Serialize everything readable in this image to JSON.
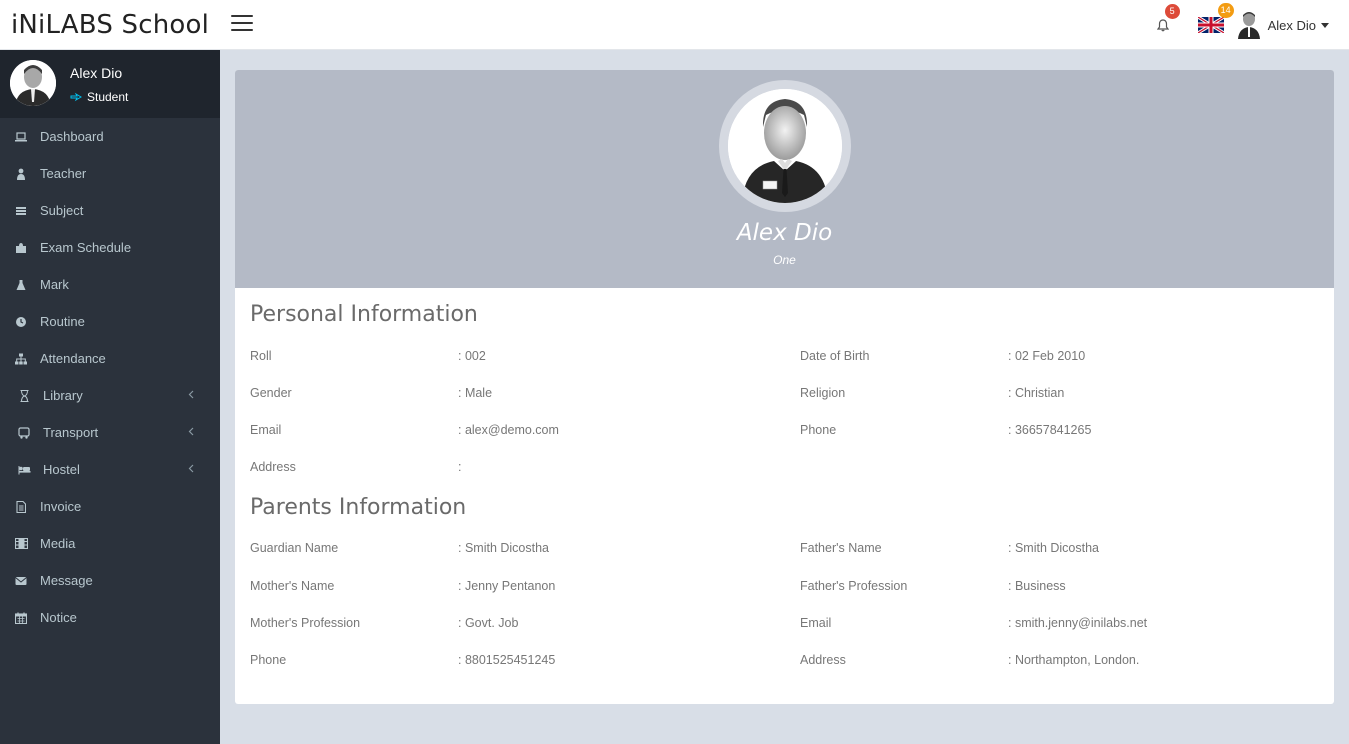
{
  "brand": "iNiLABS School",
  "header": {
    "notification_count": "5",
    "language_count": "14",
    "user_name": "Alex Dio"
  },
  "sidebar": {
    "user": {
      "name": "Alex Dio",
      "role": "Student"
    },
    "items": [
      {
        "label": "Dashboard",
        "icon": "laptop-icon"
      },
      {
        "label": "Teacher",
        "icon": "teacher-icon"
      },
      {
        "label": "Subject",
        "icon": "book-icon"
      },
      {
        "label": "Exam Schedule",
        "icon": "puzzle-icon"
      },
      {
        "label": "Mark",
        "icon": "flask-icon"
      },
      {
        "label": "Routine",
        "icon": "clock-icon"
      },
      {
        "label": "Attendance",
        "icon": "sitemap-icon"
      },
      {
        "label": "Library",
        "icon": "hourglass-icon",
        "expandable": true
      },
      {
        "label": "Transport",
        "icon": "bus-icon",
        "expandable": true
      },
      {
        "label": "Hostel",
        "icon": "bed-icon",
        "expandable": true
      },
      {
        "label": "Invoice",
        "icon": "invoice-icon"
      },
      {
        "label": "Media",
        "icon": "film-icon"
      },
      {
        "label": "Message",
        "icon": "envelope-icon"
      },
      {
        "label": "Notice",
        "icon": "calendar-icon"
      }
    ]
  },
  "profile": {
    "name": "Alex Dio",
    "class": "One"
  },
  "personal": {
    "title": "Personal Information",
    "left": [
      {
        "label": "Roll",
        "value": ": 002"
      },
      {
        "label": "Gender",
        "value": ": Male"
      },
      {
        "label": "Email",
        "value": ": alex@demo.com"
      },
      {
        "label": "Address",
        "value": ":"
      }
    ],
    "right": [
      {
        "label": "Date of Birth",
        "value": ": 02 Feb 2010"
      },
      {
        "label": "Religion",
        "value": ": Christian"
      },
      {
        "label": "Phone",
        "value": ": 36657841265"
      }
    ]
  },
  "parents": {
    "title": "Parents Information",
    "left": [
      {
        "label": "Guardian Name",
        "value": ": Smith Dicostha"
      },
      {
        "label": "Mother's Name",
        "value": ": Jenny Pentanon"
      },
      {
        "label": "Mother's Profession",
        "value": ": Govt. Job"
      },
      {
        "label": "Phone",
        "value": ": 8801525451245"
      }
    ],
    "right": [
      {
        "label": "Father's Name",
        "value": ": Smith Dicostha"
      },
      {
        "label": "Father's Profession",
        "value": ": Business"
      },
      {
        "label": "Email",
        "value": ": smith.jenny@inilabs.net"
      },
      {
        "label": "Address",
        "value": ": Northampton, London."
      }
    ]
  }
}
